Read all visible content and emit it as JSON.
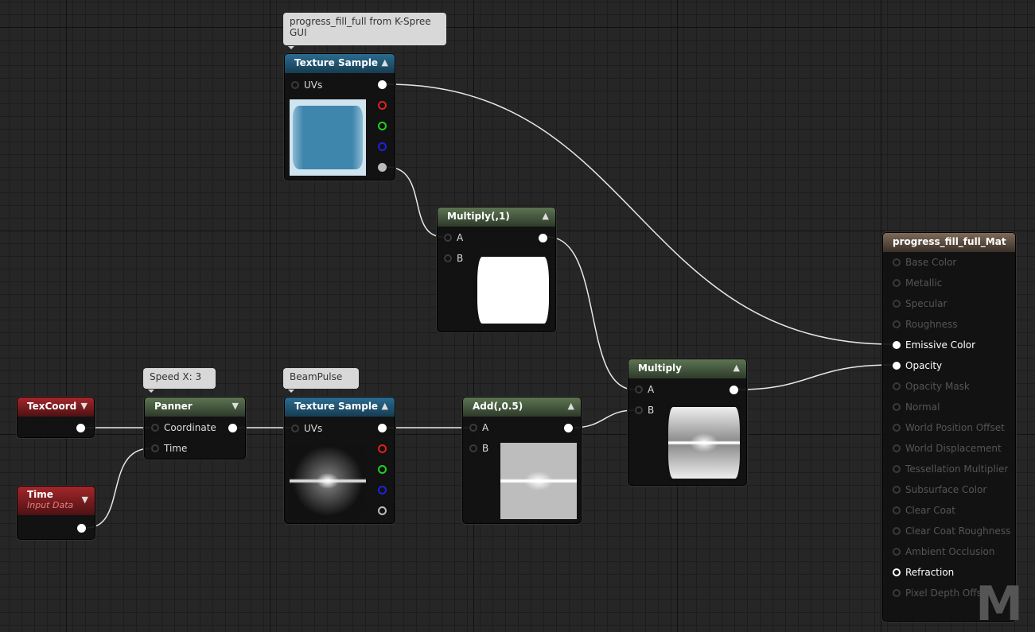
{
  "comments": {
    "texture1": "progress_fill_full from K-Spree GUI",
    "panner": "Speed X: 3",
    "texture2": "BeamPulse"
  },
  "nodes": {
    "texture_sample_1": {
      "title": "Texture Sample",
      "input": "UVs"
    },
    "multiply_1": {
      "title": "Multiply(,1)",
      "inputs": [
        "A",
        "B"
      ]
    },
    "texcoord": {
      "title": "TexCoord"
    },
    "time": {
      "title": "Time",
      "subtitle": "Input Data"
    },
    "panner": {
      "title": "Panner",
      "inputs": [
        "Coordinate",
        "Time"
      ]
    },
    "texture_sample_2": {
      "title": "Texture Sample",
      "input": "UVs"
    },
    "add": {
      "title": "Add(,0.5)",
      "inputs": [
        "A",
        "B"
      ]
    },
    "multiply": {
      "title": "Multiply",
      "inputs": [
        "A",
        "B"
      ]
    },
    "result": {
      "title": "progress_fill_full_Mat",
      "pins": [
        "Base Color",
        "Metallic",
        "Specular",
        "Roughness",
        "Emissive Color",
        "Opacity",
        "Opacity Mask",
        "Normal",
        "World Position Offset",
        "World Displacement",
        "Tessellation Multiplier",
        "Subsurface Color",
        "Clear Coat",
        "Clear Coat Roughness",
        "Ambient Occlusion",
        "Refraction",
        "Pixel Depth Offset"
      ],
      "connected": [
        "Emissive Color",
        "Opacity",
        "Refraction"
      ]
    }
  },
  "watermark": "M",
  "colors": {
    "texture_header": "#2a6c90",
    "math_header": "#5d7553",
    "input_header": "#a3262a",
    "result_header": "#7d6a58"
  }
}
